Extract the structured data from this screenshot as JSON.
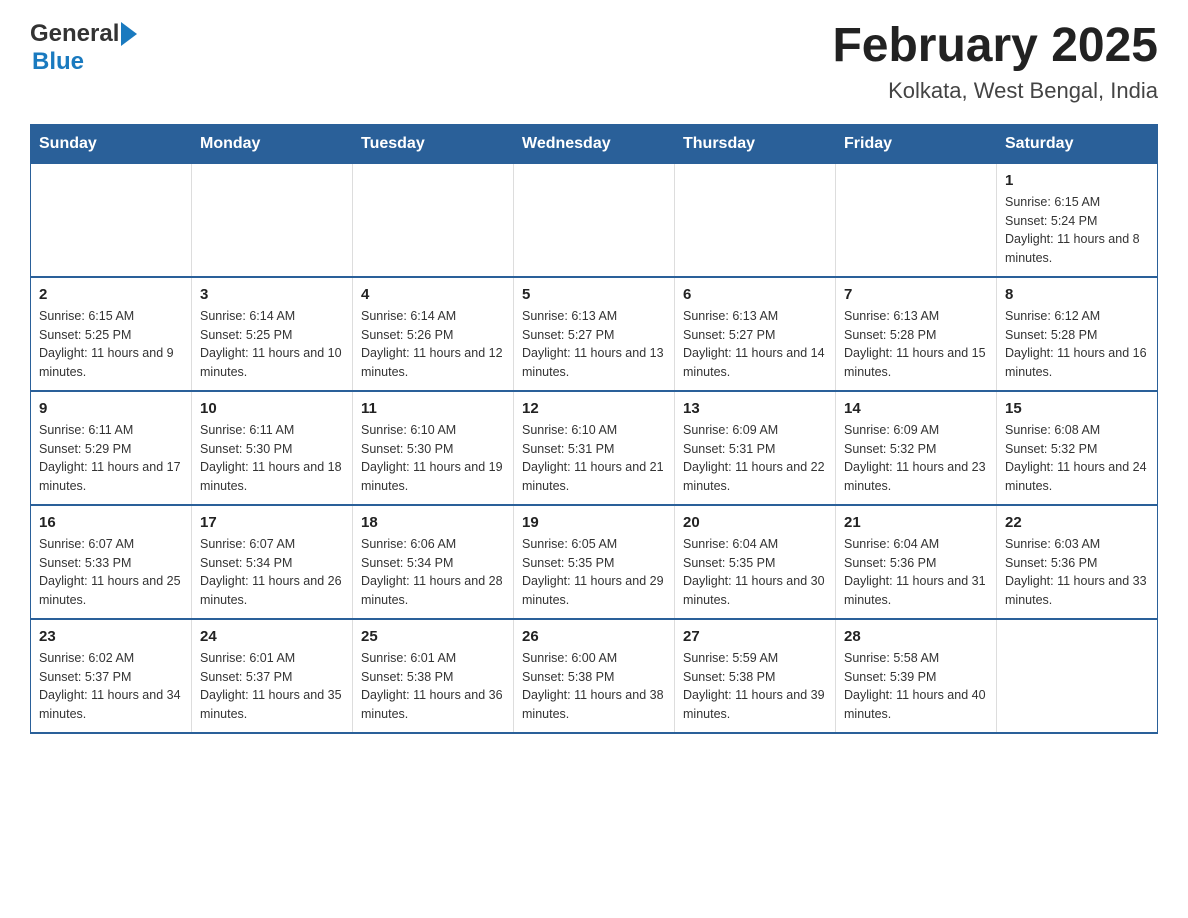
{
  "header": {
    "logo_general": "General",
    "logo_blue": "Blue",
    "title": "February 2025",
    "subtitle": "Kolkata, West Bengal, India"
  },
  "days_of_week": [
    "Sunday",
    "Monday",
    "Tuesday",
    "Wednesday",
    "Thursday",
    "Friday",
    "Saturday"
  ],
  "weeks": [
    [
      {
        "day": "",
        "sunrise": "",
        "sunset": "",
        "daylight": ""
      },
      {
        "day": "",
        "sunrise": "",
        "sunset": "",
        "daylight": ""
      },
      {
        "day": "",
        "sunrise": "",
        "sunset": "",
        "daylight": ""
      },
      {
        "day": "",
        "sunrise": "",
        "sunset": "",
        "daylight": ""
      },
      {
        "day": "",
        "sunrise": "",
        "sunset": "",
        "daylight": ""
      },
      {
        "day": "",
        "sunrise": "",
        "sunset": "",
        "daylight": ""
      },
      {
        "day": "1",
        "sunrise": "Sunrise: 6:15 AM",
        "sunset": "Sunset: 5:24 PM",
        "daylight": "Daylight: 11 hours and 8 minutes."
      }
    ],
    [
      {
        "day": "2",
        "sunrise": "Sunrise: 6:15 AM",
        "sunset": "Sunset: 5:25 PM",
        "daylight": "Daylight: 11 hours and 9 minutes."
      },
      {
        "day": "3",
        "sunrise": "Sunrise: 6:14 AM",
        "sunset": "Sunset: 5:25 PM",
        "daylight": "Daylight: 11 hours and 10 minutes."
      },
      {
        "day": "4",
        "sunrise": "Sunrise: 6:14 AM",
        "sunset": "Sunset: 5:26 PM",
        "daylight": "Daylight: 11 hours and 12 minutes."
      },
      {
        "day": "5",
        "sunrise": "Sunrise: 6:13 AM",
        "sunset": "Sunset: 5:27 PM",
        "daylight": "Daylight: 11 hours and 13 minutes."
      },
      {
        "day": "6",
        "sunrise": "Sunrise: 6:13 AM",
        "sunset": "Sunset: 5:27 PM",
        "daylight": "Daylight: 11 hours and 14 minutes."
      },
      {
        "day": "7",
        "sunrise": "Sunrise: 6:13 AM",
        "sunset": "Sunset: 5:28 PM",
        "daylight": "Daylight: 11 hours and 15 minutes."
      },
      {
        "day": "8",
        "sunrise": "Sunrise: 6:12 AM",
        "sunset": "Sunset: 5:28 PM",
        "daylight": "Daylight: 11 hours and 16 minutes."
      }
    ],
    [
      {
        "day": "9",
        "sunrise": "Sunrise: 6:11 AM",
        "sunset": "Sunset: 5:29 PM",
        "daylight": "Daylight: 11 hours and 17 minutes."
      },
      {
        "day": "10",
        "sunrise": "Sunrise: 6:11 AM",
        "sunset": "Sunset: 5:30 PM",
        "daylight": "Daylight: 11 hours and 18 minutes."
      },
      {
        "day": "11",
        "sunrise": "Sunrise: 6:10 AM",
        "sunset": "Sunset: 5:30 PM",
        "daylight": "Daylight: 11 hours and 19 minutes."
      },
      {
        "day": "12",
        "sunrise": "Sunrise: 6:10 AM",
        "sunset": "Sunset: 5:31 PM",
        "daylight": "Daylight: 11 hours and 21 minutes."
      },
      {
        "day": "13",
        "sunrise": "Sunrise: 6:09 AM",
        "sunset": "Sunset: 5:31 PM",
        "daylight": "Daylight: 11 hours and 22 minutes."
      },
      {
        "day": "14",
        "sunrise": "Sunrise: 6:09 AM",
        "sunset": "Sunset: 5:32 PM",
        "daylight": "Daylight: 11 hours and 23 minutes."
      },
      {
        "day": "15",
        "sunrise": "Sunrise: 6:08 AM",
        "sunset": "Sunset: 5:32 PM",
        "daylight": "Daylight: 11 hours and 24 minutes."
      }
    ],
    [
      {
        "day": "16",
        "sunrise": "Sunrise: 6:07 AM",
        "sunset": "Sunset: 5:33 PM",
        "daylight": "Daylight: 11 hours and 25 minutes."
      },
      {
        "day": "17",
        "sunrise": "Sunrise: 6:07 AM",
        "sunset": "Sunset: 5:34 PM",
        "daylight": "Daylight: 11 hours and 26 minutes."
      },
      {
        "day": "18",
        "sunrise": "Sunrise: 6:06 AM",
        "sunset": "Sunset: 5:34 PM",
        "daylight": "Daylight: 11 hours and 28 minutes."
      },
      {
        "day": "19",
        "sunrise": "Sunrise: 6:05 AM",
        "sunset": "Sunset: 5:35 PM",
        "daylight": "Daylight: 11 hours and 29 minutes."
      },
      {
        "day": "20",
        "sunrise": "Sunrise: 6:04 AM",
        "sunset": "Sunset: 5:35 PM",
        "daylight": "Daylight: 11 hours and 30 minutes."
      },
      {
        "day": "21",
        "sunrise": "Sunrise: 6:04 AM",
        "sunset": "Sunset: 5:36 PM",
        "daylight": "Daylight: 11 hours and 31 minutes."
      },
      {
        "day": "22",
        "sunrise": "Sunrise: 6:03 AM",
        "sunset": "Sunset: 5:36 PM",
        "daylight": "Daylight: 11 hours and 33 minutes."
      }
    ],
    [
      {
        "day": "23",
        "sunrise": "Sunrise: 6:02 AM",
        "sunset": "Sunset: 5:37 PM",
        "daylight": "Daylight: 11 hours and 34 minutes."
      },
      {
        "day": "24",
        "sunrise": "Sunrise: 6:01 AM",
        "sunset": "Sunset: 5:37 PM",
        "daylight": "Daylight: 11 hours and 35 minutes."
      },
      {
        "day": "25",
        "sunrise": "Sunrise: 6:01 AM",
        "sunset": "Sunset: 5:38 PM",
        "daylight": "Daylight: 11 hours and 36 minutes."
      },
      {
        "day": "26",
        "sunrise": "Sunrise: 6:00 AM",
        "sunset": "Sunset: 5:38 PM",
        "daylight": "Daylight: 11 hours and 38 minutes."
      },
      {
        "day": "27",
        "sunrise": "Sunrise: 5:59 AM",
        "sunset": "Sunset: 5:38 PM",
        "daylight": "Daylight: 11 hours and 39 minutes."
      },
      {
        "day": "28",
        "sunrise": "Sunrise: 5:58 AM",
        "sunset": "Sunset: 5:39 PM",
        "daylight": "Daylight: 11 hours and 40 minutes."
      },
      {
        "day": "",
        "sunrise": "",
        "sunset": "",
        "daylight": ""
      }
    ]
  ]
}
